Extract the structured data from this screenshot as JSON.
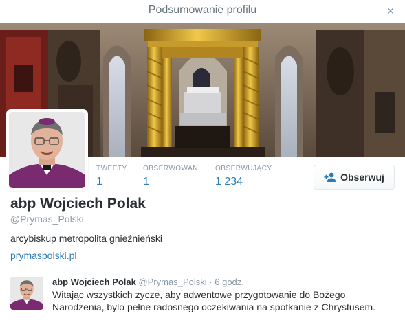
{
  "modal": {
    "title": "Podsumowanie profilu",
    "close_symbol": "×"
  },
  "profile": {
    "name": "abp Wojciech Polak",
    "handle": "@Prymas_Polski",
    "bio": "arcybiskup metropolita gnieźnieński",
    "url": "prymaspolski.pl",
    "stats": [
      {
        "label": "TWEETY",
        "value": "1"
      },
      {
        "label": "OBSERWOWANI",
        "value": "1"
      },
      {
        "label": "OBSERWUJĄCY",
        "value": "1 234"
      }
    ],
    "follow_label": "Obserwuj",
    "follow_icon": "add-user-icon"
  },
  "tweet": {
    "name": "abp Wojciech Polak",
    "handle": "@Prymas_Polski",
    "separator": "·",
    "time": "6 godz.",
    "text": "Witając wszystkich zycze, aby adwentowe przygotowanie do Bożego Narodzenia, bylo pełne radosnego oczekiwania na spotkanie z Chrystusem."
  },
  "colors": {
    "link": "#2b7bb9",
    "muted": "#8899a6",
    "text": "#292f33",
    "border": "#e1e8ed"
  }
}
